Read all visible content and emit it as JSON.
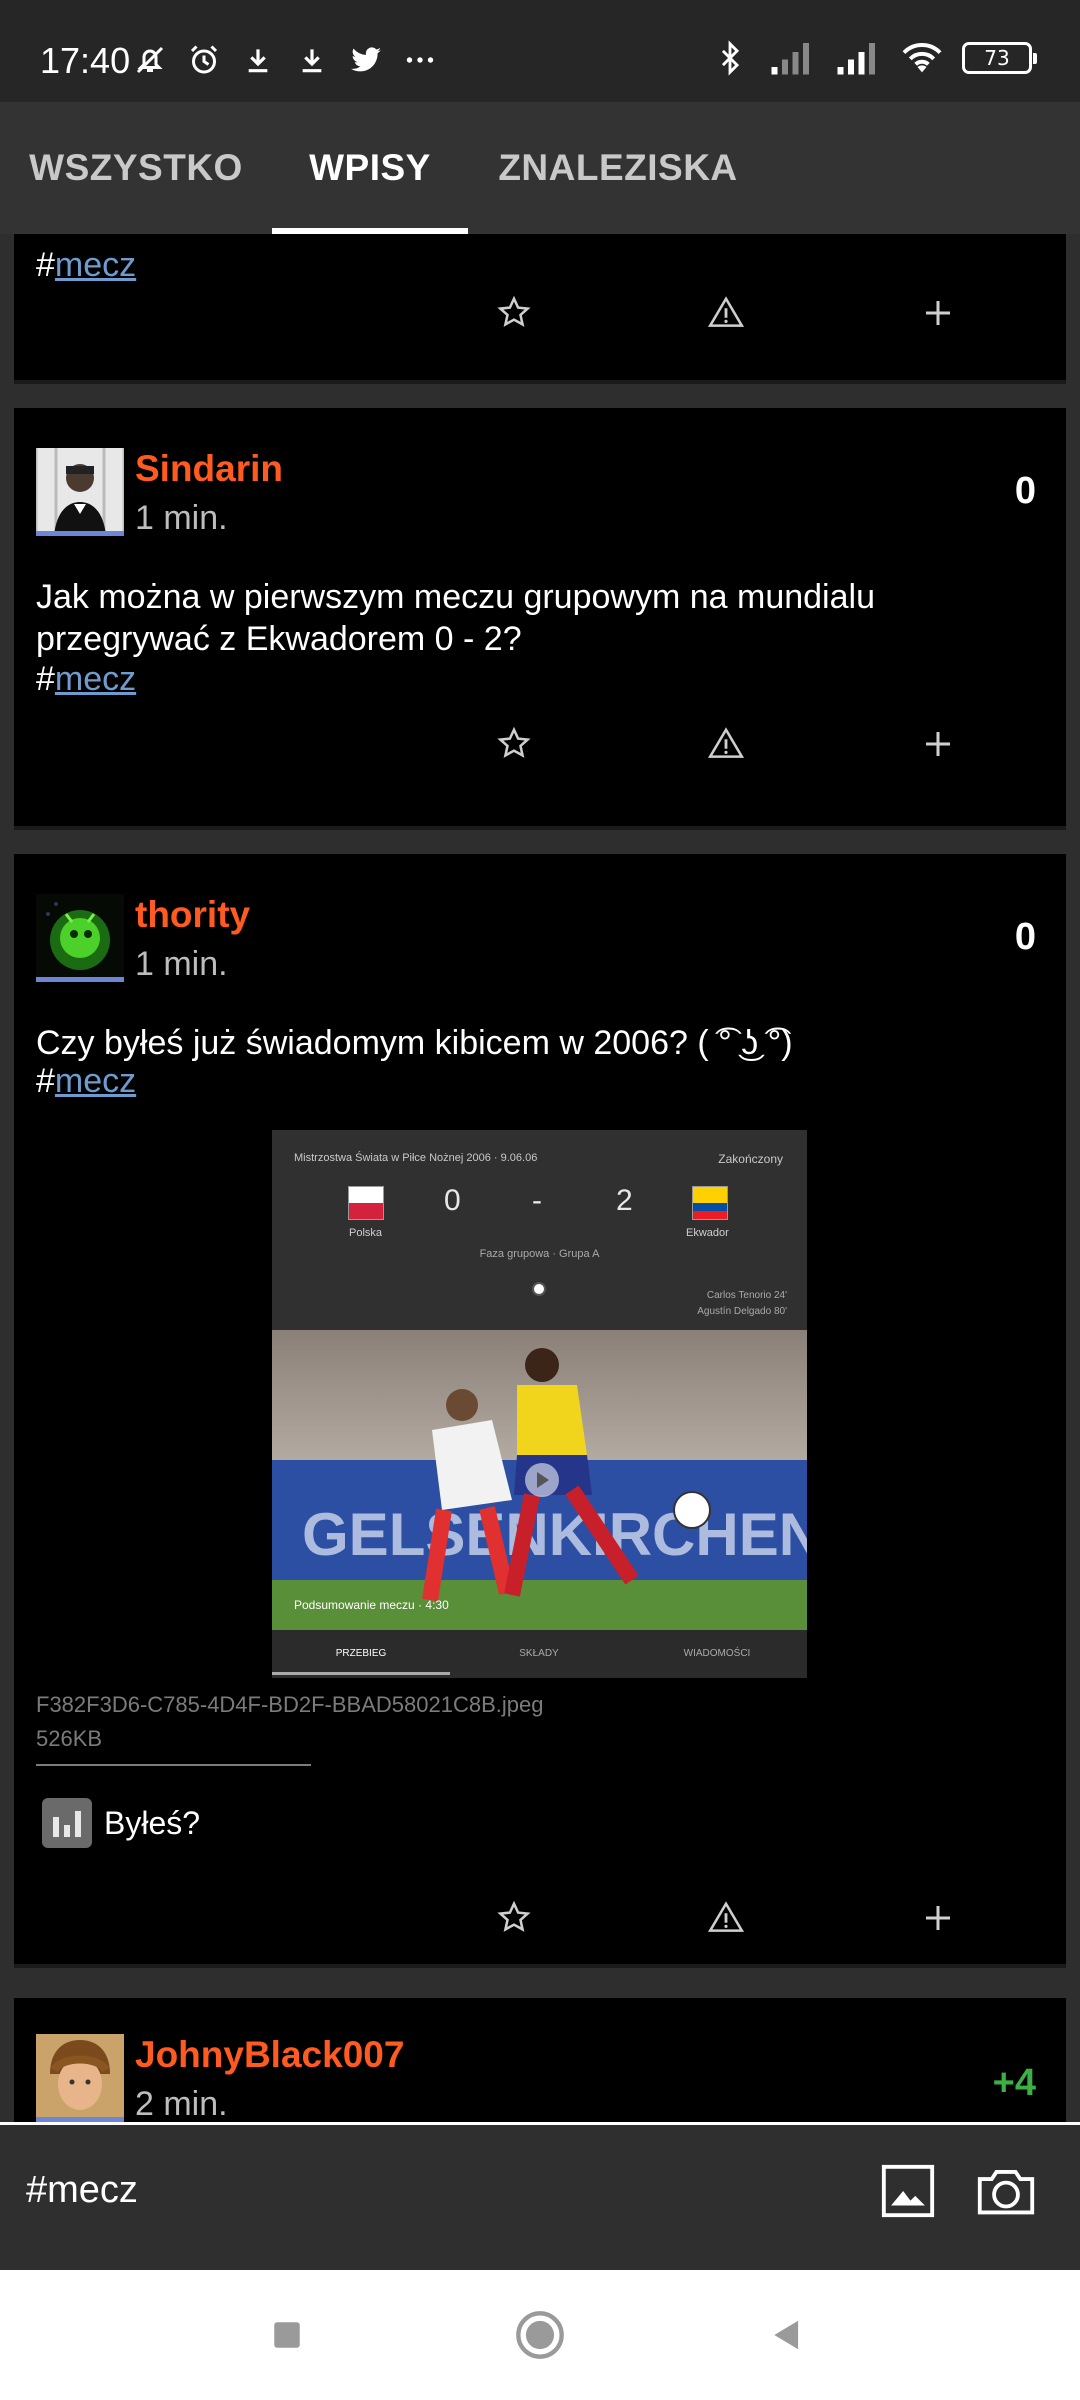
{
  "status_bar": {
    "time": "17:40",
    "left_icons": [
      "muted-bell-icon",
      "alarm-icon",
      "download-icon",
      "download-icon",
      "twitter-icon",
      "more-dots-icon"
    ],
    "right_icons": [
      "bluetooth-icon",
      "signal-icon",
      "signal-icon",
      "wifi-icon"
    ],
    "battery": "73",
    "battery_level_percent": 73
  },
  "tabs": [
    {
      "label": "WSZYSTKO",
      "active": false
    },
    {
      "label": "WPISY",
      "active": true
    },
    {
      "label": "ZNALEZISKA",
      "active": false
    }
  ],
  "posts": [
    {
      "tag_hash": "#",
      "tag": "mecz",
      "actions": [
        "star-icon",
        "warning-icon",
        "plus-icon"
      ]
    },
    {
      "author": "Sindarin",
      "time": "1 min.",
      "votes": "0",
      "text": "Jak można w pierwszym meczu grupowym na mundialu przegrywać z Ekwadorem 0 - 2?",
      "tag_hash": "#",
      "tag": "mecz"
    },
    {
      "author": "thority",
      "time": "1 min.",
      "votes": "0",
      "text": "Czy byłeś już świadomym kibicem w 2006? ( ͡° ͜ʖ ͡°)",
      "tag_hash": "#",
      "tag": "mecz",
      "media": {
        "title": "Mistrzostwa Świata w Piłce Nożnej 2006 · 9.06.06",
        "status": "Zakończony",
        "home_team": "Polska",
        "away_team": "Ekwador",
        "home_score": "0",
        "separator": "-",
        "away_score": "2",
        "stage": "Faza grupowa · Grupa A",
        "scorer_1": "Carlos Tenorio 24'",
        "scorer_2": "Agustín Delgado 80'",
        "caption": "Podsumowanie meczu · 4:30",
        "tabs": [
          "PRZEBIEG",
          "SKŁADY",
          "WIADOMOŚCI"
        ]
      },
      "file_name": "F382F3D6-C785-4D4F-BD2F-BBAD58021C8B.jpeg",
      "file_size": "526KB",
      "poll_label": "Byłeś?"
    },
    {
      "author": "JohnyBlack007",
      "time": "2 min.",
      "votes": "+4"
    }
  ],
  "input": {
    "text": "#mecz",
    "buttons": [
      "image-icon",
      "camera-icon"
    ]
  },
  "nav": [
    "recents-icon",
    "home-icon",
    "back-icon"
  ],
  "colors": {
    "author": "#ff5a1f",
    "link": "#6f9ccf",
    "positive": "#3cb043",
    "card": "#000000",
    "background": "#2e2e2e"
  }
}
